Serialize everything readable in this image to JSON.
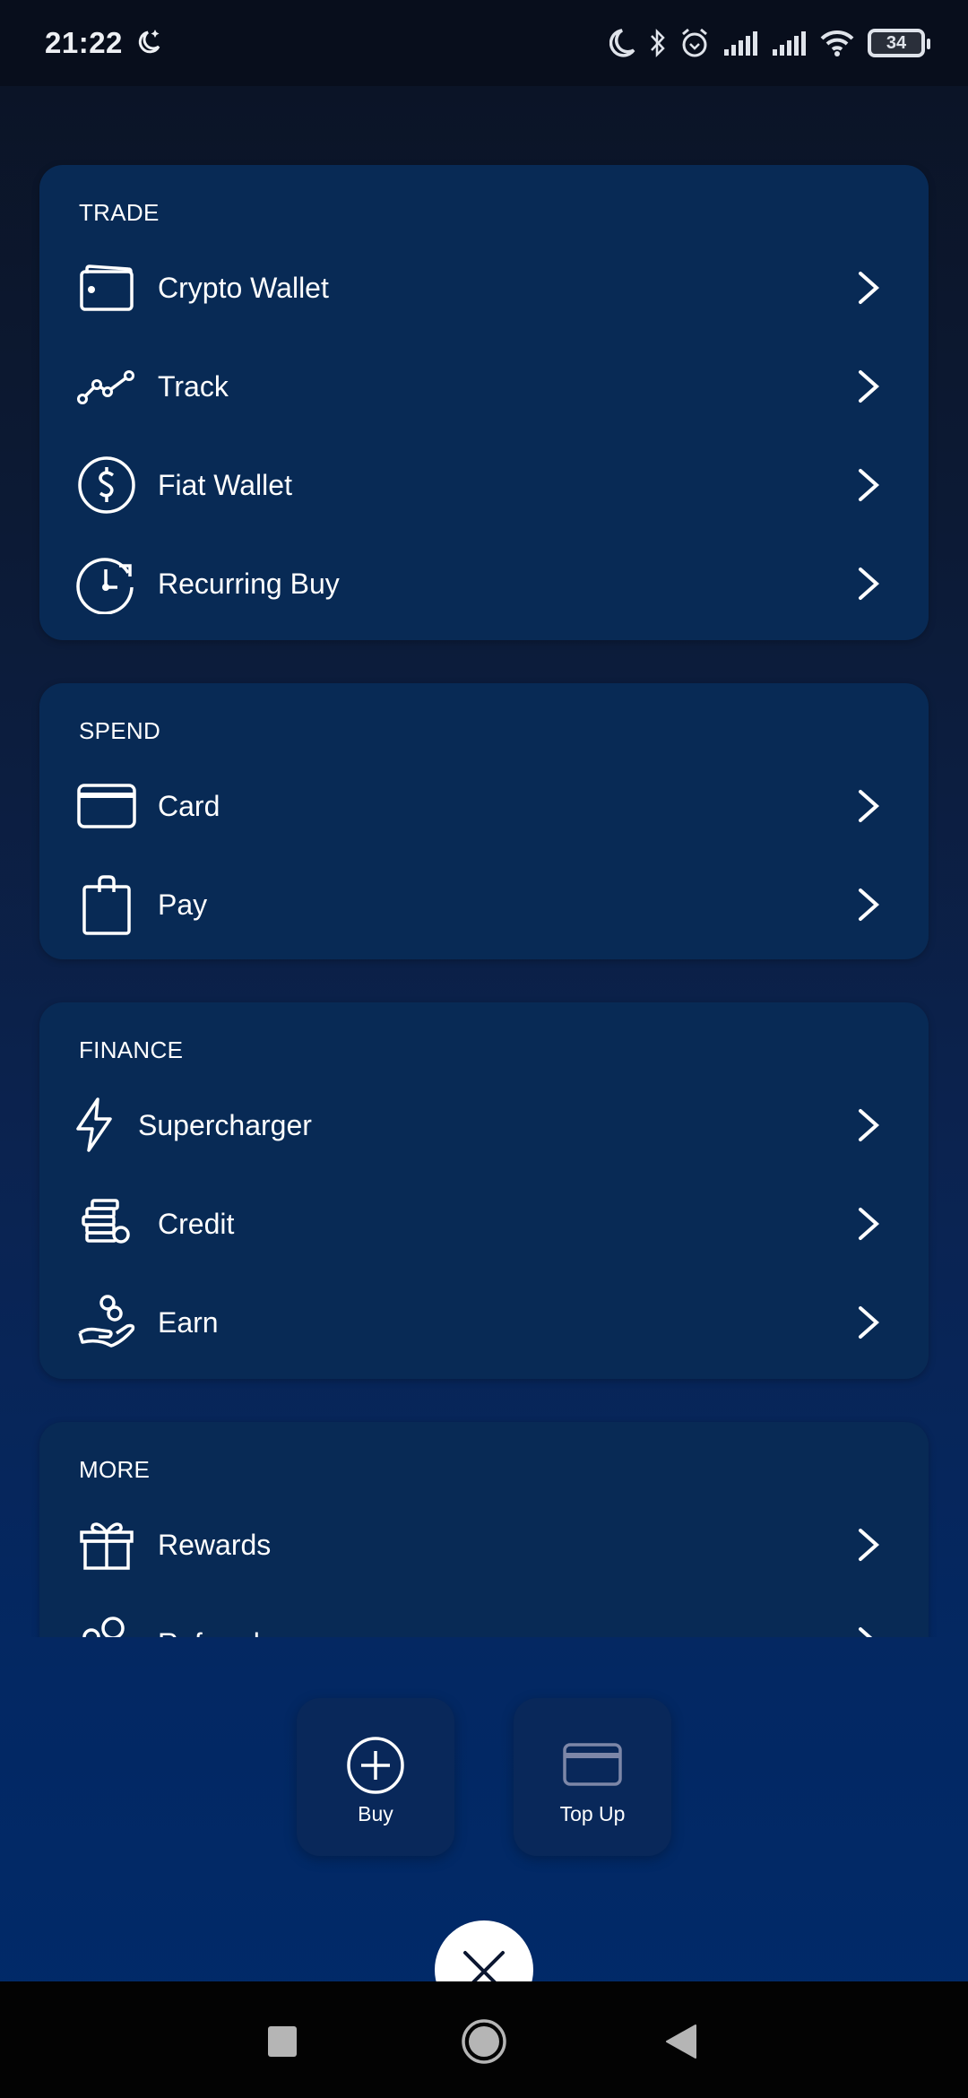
{
  "status_bar": {
    "time": "21:22",
    "battery_level": "34",
    "icons": [
      "moon-stars-icon",
      "moon-icon",
      "bluetooth-icon",
      "alarm-icon",
      "signal-icon",
      "signal-icon",
      "wifi-icon",
      "battery-icon"
    ]
  },
  "sections": [
    {
      "title": "TRADE",
      "items": [
        {
          "label": "Crypto Wallet",
          "icon": "wallet-icon"
        },
        {
          "label": "Track",
          "icon": "line-chart-icon"
        },
        {
          "label": "Fiat Wallet",
          "icon": "dollar-circle-icon"
        },
        {
          "label": "Recurring Buy",
          "icon": "clock-refresh-icon"
        }
      ]
    },
    {
      "title": "SPEND",
      "items": [
        {
          "label": "Card",
          "icon": "credit-card-icon"
        },
        {
          "label": "Pay",
          "icon": "shopping-bag-icon"
        }
      ]
    },
    {
      "title": "FINANCE",
      "items": [
        {
          "label": "Supercharger",
          "icon": "lightning-icon"
        },
        {
          "label": "Credit",
          "icon": "coin-stack-icon"
        },
        {
          "label": "Earn",
          "icon": "hand-coins-icon"
        }
      ]
    },
    {
      "title": "MORE",
      "items": [
        {
          "label": "Rewards",
          "icon": "gift-icon"
        },
        {
          "label": "Referral",
          "icon": "users-icon"
        }
      ]
    }
  ],
  "actions": [
    {
      "label": "Buy",
      "icon": "plus-circle-icon"
    },
    {
      "label": "Top Up",
      "icon": "credit-card-icon"
    }
  ],
  "close_button": {
    "icon": "close-icon"
  },
  "nav": [
    "recents-button",
    "home-button",
    "back-button"
  ],
  "colors": {
    "card_bg": "#082a55",
    "status_bar_bg": "#080e1c",
    "nav_bar_bg": "#030303",
    "text": "#ffffff",
    "topup_icon": "#7d87a8"
  }
}
